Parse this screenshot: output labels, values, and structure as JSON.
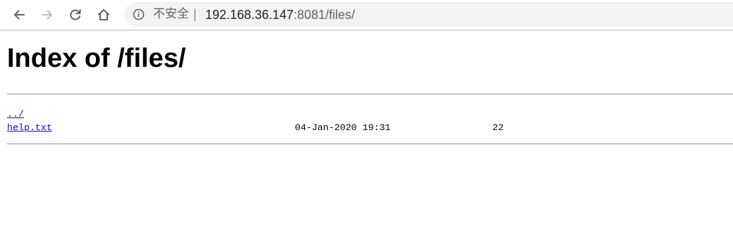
{
  "browser": {
    "security_label": "不安全",
    "url_separator": "|",
    "url_host": "192.168.36.147",
    "url_rest": ":8081/files/"
  },
  "page": {
    "title": "Index of /files/",
    "entries": [
      {
        "name": "../",
        "date": "",
        "size": ""
      },
      {
        "name": "help.txt",
        "date": "04-Jan-2020 19:31",
        "size": "22"
      }
    ]
  },
  "colors": {
    "link": "#0000ee",
    "omnibox_bg": "#f1f3f4",
    "icon": "#5f6368"
  }
}
